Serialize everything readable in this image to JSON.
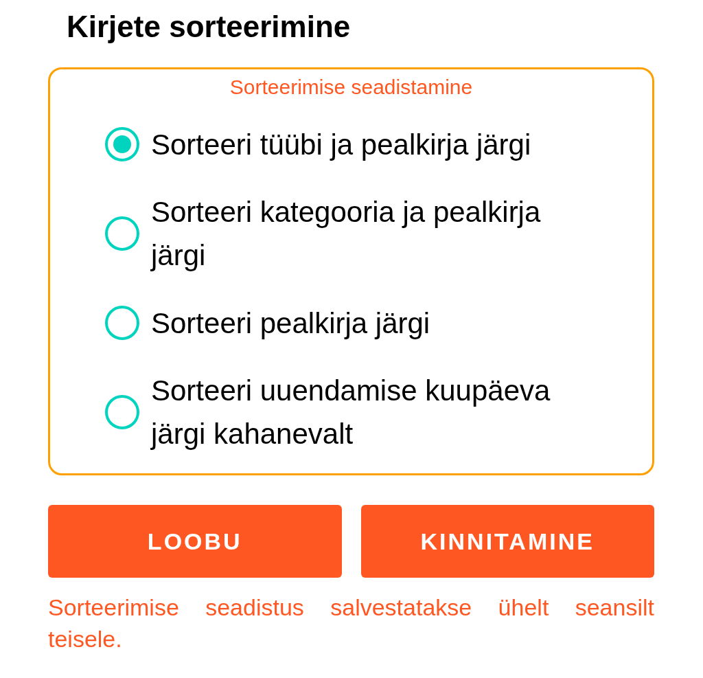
{
  "title": "Kirjete sorteerimine",
  "group": {
    "legend": "Sorteerimise seadistamine",
    "options": [
      {
        "label": "Sorteeri tüübi ja pealkirja järgi",
        "selected": true
      },
      {
        "label": "Sorteeri kategooria ja pealkirja järgi",
        "selected": false
      },
      {
        "label": "Sorteeri pealkirja järgi",
        "selected": false
      },
      {
        "label": "Sorteeri uuendamise kuupäeva järgi kahanevalt",
        "selected": false
      }
    ]
  },
  "buttons": [
    {
      "label": "LOOBU"
    },
    {
      "label": "KINNITAMINE"
    }
  ],
  "note": "Sorteerimise seadistus salvestatakse ühelt seansilt teisele."
}
